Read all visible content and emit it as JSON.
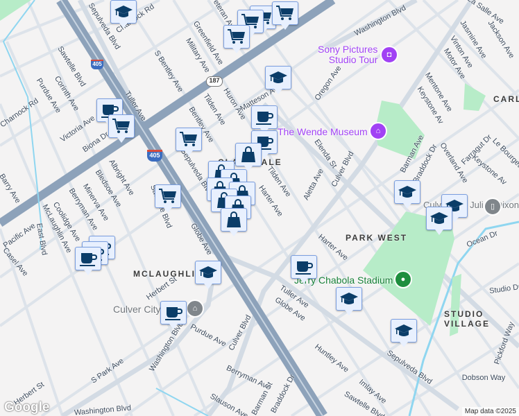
{
  "map": {
    "neighborhoods": [
      "MCLAUGHLIN",
      "PARK WEST",
      "STUDIO VILLAGE",
      "CARL",
      "CLARKDALE"
    ],
    "pois": [
      {
        "name": "Sony Pictures Studio Tour",
        "line1": "Sony Pictures",
        "line2": "Studio Tour",
        "color": "#a142f4"
      },
      {
        "name": "The Wende Museum",
        "color": "#a142f4"
      },
      {
        "name": "Jerry Chabola Stadium",
        "color": "#188038"
      },
      {
        "name": "Culver City",
        "color": "#70757a"
      },
      {
        "name": "Culver City Julian Dixon Library",
        "color": "#70757a"
      }
    ],
    "shields": [
      "405",
      "405",
      "187"
    ],
    "streets": [
      "Sepulveda Blvd",
      "Charnock Rd",
      "Greenfield Ave",
      "Military Ave",
      "Veteran Ave",
      "S Bentley Ave",
      "Huron Ave",
      "Tilden Ave",
      "Bentley Ave",
      "Tuller Ave",
      "Sawtelle Blvd",
      "Corinth Ave",
      "Purdue Ave",
      "Charnock Rd",
      "Victoria Ave",
      "Biona Dr",
      "Albright Ave",
      "Bledsoe Ave",
      "Minerva Ave",
      "Berryman Ave",
      "Coolidge Ave",
      "Barry Ave",
      "McLaughlin Ave",
      "East Blvd",
      "Pacific Ave",
      "Casel Ave",
      "Sawtelle Blvd",
      "Globe Ave",
      "Herbert St",
      "Purdue Ave",
      "Washington Blvd",
      "S Park Ave",
      "Herbert St",
      "Washington Blvd",
      "Culver Blvd",
      "Berryman Ave",
      "Barman St",
      "Slauson Ave",
      "Braddock Dr",
      "Sawtelle Blvd",
      "Imlay Ave",
      "Huntley Ave",
      "Globe Ave",
      "Tuller Ave",
      "Harter Ave",
      "Harter Ave",
      "Tilden Ave",
      "Aletta Ave",
      "Elenda St",
      "Culver Blvd",
      "Oregon Ave",
      "Washington Blvd",
      "Matteson Ave",
      "La Salle Ave",
      "Jackson Ave",
      "Jasmine Ave",
      "Vinton Ave",
      "Motor Ave",
      "Mentone Ave",
      "Keystone Av",
      "Barman Ave",
      "Braddock Dr",
      "Overland Ave",
      "Farragut Dr",
      "Keystone Av",
      "Le Bourget Ave",
      "Ocean Dr",
      "Studio Dr",
      "Pickford Way",
      "Dobson Way",
      "Sepulveda Blvd",
      "Sepulveda Blvd"
    ],
    "markers": [
      "school",
      "shopping-cart",
      "shopping-cart",
      "shopping-cart",
      "shopping-cart",
      "school",
      "coffee",
      "coffee",
      "shopping-bag",
      "coffee",
      "shopping-cart",
      "shopping-cart",
      "shopping-bag",
      "shopping-bag",
      "shopping-bag",
      "shopping-bag",
      "shopping-bag",
      "shopping-bag",
      "shopping-bag",
      "shopping-cart",
      "coffee",
      "coffee",
      "coffee",
      "school",
      "coffee",
      "school",
      "school",
      "school",
      "coffee",
      "school",
      "school"
    ],
    "logo": "Google",
    "attribution": "Map data ©2025",
    "colors": {
      "marker_bg": "#e8f0fe",
      "marker_icon": "#0b3d68",
      "park": "#b7ecc8",
      "freeway": "#8da2ba",
      "water": "#8fd6f0"
    }
  }
}
